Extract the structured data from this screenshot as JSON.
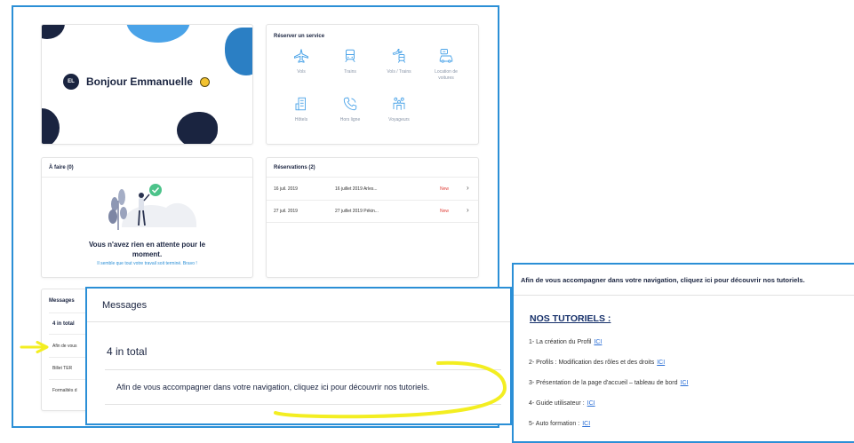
{
  "dashboard": {
    "greeting": "Bonjour Emmanuelle",
    "avatar_initials": "EL",
    "booking": {
      "title": "Réserver un service",
      "services": [
        {
          "label": "Vols",
          "icon": "plane-icon"
        },
        {
          "label": "Trains",
          "icon": "train-icon"
        },
        {
          "label": "Vols / Trains",
          "icon": "plane-train-icon"
        },
        {
          "label": "Location de voitures",
          "icon": "car-rental-icon"
        },
        {
          "label": "Hôtels",
          "icon": "hotel-icon"
        },
        {
          "label": "Hors ligne",
          "icon": "phone-icon"
        },
        {
          "label": "Voyageurs",
          "icon": "travelers-icon"
        }
      ]
    },
    "todo": {
      "title": "À faire (0)",
      "empty_main": "Vous n'avez rien en attente pour le moment.",
      "empty_sub": "Il semble que tout votre travail soit terminé. Bravo !"
    },
    "reservations": {
      "title": "Réservations (2)",
      "rows": [
        {
          "date": "16 juil. 2019",
          "name": "16 juillet 2019 Arles...",
          "status": "New"
        },
        {
          "date": "27 juil. 2019",
          "name": "27 juillet 2019 Pékin...",
          "status": "New"
        }
      ]
    },
    "messages": {
      "title": "Messages",
      "total": "4 in total",
      "items": [
        "Afin de vous",
        "Billet TER",
        "Formalités d"
      ]
    }
  },
  "zoom": {
    "title": "Messages",
    "total": "4 in total",
    "message": "Afin de vous accompagner dans votre navigation, cliquez ici pour découvrir nos tutoriels."
  },
  "tutorials": {
    "intro": "Afin de vous accompagner dans votre navigation, cliquez ici pour découvrir nos tutoriels.",
    "heading": "NOS TUTORIELS :",
    "link_label": "ICI",
    "items": [
      "1- La création du Profil",
      "2- Profils : Modification des rôles et des droits",
      "3- Présentation de la page d'accueil – tableau de bord",
      "4- Guide utilisateur :",
      "5- Auto formation :"
    ]
  },
  "colors": {
    "frame_blue": "#2b8fd6",
    "navy": "#1a2440",
    "accent_blue": "#4aa3e8",
    "new_red": "#e0413a",
    "highlight_yellow": "#f3ee21"
  }
}
